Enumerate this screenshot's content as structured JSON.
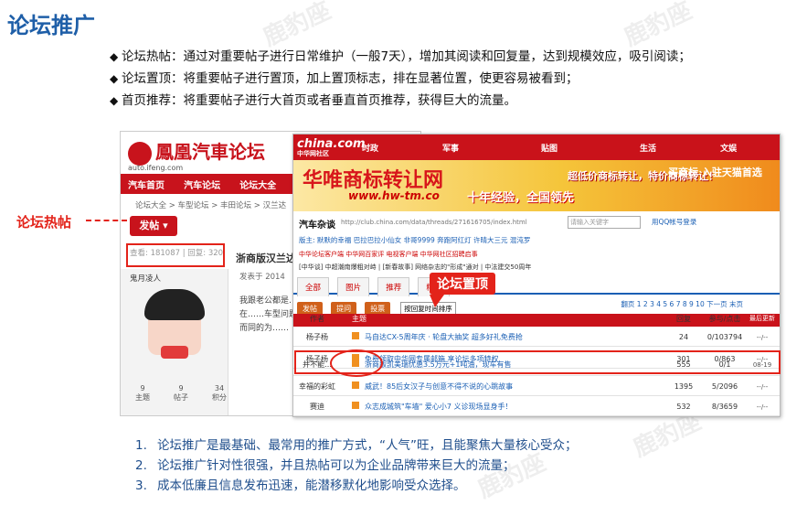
{
  "title": "论坛推广",
  "bullets": [
    "论坛热帖：通过对重要帖子进行日常维护（一般7天），增加其阅读和回复量，达到规模效应，吸引阅读；",
    "论坛置顶：将重要帖子进行置顶，加上置顶标志，排在显著位置，使更容易被看到；",
    "首页推荐：将重要帖子进行大首页或者垂直首页推荐，获得巨大的流量。"
  ],
  "watermark": "鹿豹座",
  "ifeng": {
    "logo": "鳳凰汽車论坛",
    "logo_sub": "auto.ifeng.com",
    "nav": [
      "汽车首页",
      "汽车论坛",
      "论坛大全"
    ],
    "crumb": "论坛大全 > 车型论坛 > 丰田论坛 > 汉兰达",
    "post_button": "发帖 ▾",
    "stats": "查看: 181087 | 回复: 320",
    "thread_title": "浙商版汉兰达",
    "user": "鬼月凌人",
    "posted": "发表于 2014",
    "body": "我跟老公都是……撞提我考驾照……趣，同时也在……车型问题上，……车型。而浙商……不约而同的为……",
    "counts": [
      {
        "value": "9",
        "label": "主题"
      },
      {
        "value": "9",
        "label": "帖子"
      },
      {
        "value": "34",
        "label": "积分"
      }
    ]
  },
  "china": {
    "logo": "china.com",
    "logo_sub": "中华网社区",
    "channels": [
      "时政",
      "军事",
      "贴图",
      "生活",
      "文娱"
    ],
    "banner_main": "华唯商标转让网",
    "banner_url": "www.hw-tm.co",
    "banner_exp": "十年经验，全国领先",
    "banner_mid": "超低价商标转让，特价商标转让！",
    "banner_right": "买商标 入驻天猫首选",
    "forum_title": "汽车杂谈",
    "url": "http://club.china.com/data/threads/271616705/index.html",
    "search_placeholder": "请输入关键字",
    "qq_login": "用QQ帐号登录",
    "tags": "版主: 默默的幸福  巴拉巴拉小仙女  非哥9999  奔跑阿红灯  许晴大三元  混沌罗",
    "links": "中华论坛客户端   中华网百家评   电视客户端   中华网社区招聘启事",
    "notice": "[中华谈] 中超潮南爆粗对峙 | [新春故事] 网络杂志的\"形成\"通对 | 中法建交50周年",
    "tabs": [
      "全部",
      "图片",
      "推荐",
      "精华"
    ],
    "toolbar": {
      "post": "发帖",
      "ask": "提问",
      "vote": "投票",
      "sort": "按回复时间排序"
    },
    "pager": "翻页 1 2 3 4 5 6 7 8 9 10 下一页 末页",
    "table_head": {
      "author": "作者",
      "subject": "主题",
      "reply": "回复",
      "view": "参与/点击",
      "last": "最后更新"
    },
    "rows": [
      {
        "author": "杨子杨",
        "subject": "马自达CX-5周年庆 · 轮盘大抽奖 超多好礼免费抢",
        "reply": "24",
        "view": "0/103794",
        "last": "--/--"
      },
      {
        "author": "杨子杨",
        "subject": "免费领取中华网专属邮箱 享论坛多项特权",
        "reply": "301",
        "view": "0/863",
        "last": "--/--"
      },
      {
        "author": "并不能...",
        "subject": "浙商版凯美瑞优惠3.5万元+1吨油，现车有售",
        "reply": "555",
        "view": "0/1",
        "last": "08-19"
      },
      {
        "author": "幸福的彩虹",
        "subject": "威武！85后女汉子与创意不得不说的心跳故事",
        "reply": "1395",
        "view": "5/2096",
        "last": "--/--"
      },
      {
        "author": "赛迪",
        "subject": "众志成城筑\"车墙\" 爱心小7 义诊现场显身手！",
        "reply": "532",
        "view": "8/3659",
        "last": "--/--"
      }
    ]
  },
  "annotations": {
    "hot": "论坛热帖",
    "top": "论坛置顶"
  },
  "points": [
    {
      "n": "1.",
      "text": "论坛推广是最基础、最常用的推广方式，“人气”旺，且能聚焦大量核心受众；"
    },
    {
      "n": "2.",
      "text": "论坛推广针对性很强，并且热帖可以为企业品牌带来巨大的流量；"
    },
    {
      "n": "3.",
      "text": "成本低廉且信息发布迅速，能潜移默化地影响受众选择。"
    }
  ],
  "colors": {
    "accent": "#e3231a",
    "title": "#1f5fa8",
    "numbered": "#1f4e8c"
  }
}
